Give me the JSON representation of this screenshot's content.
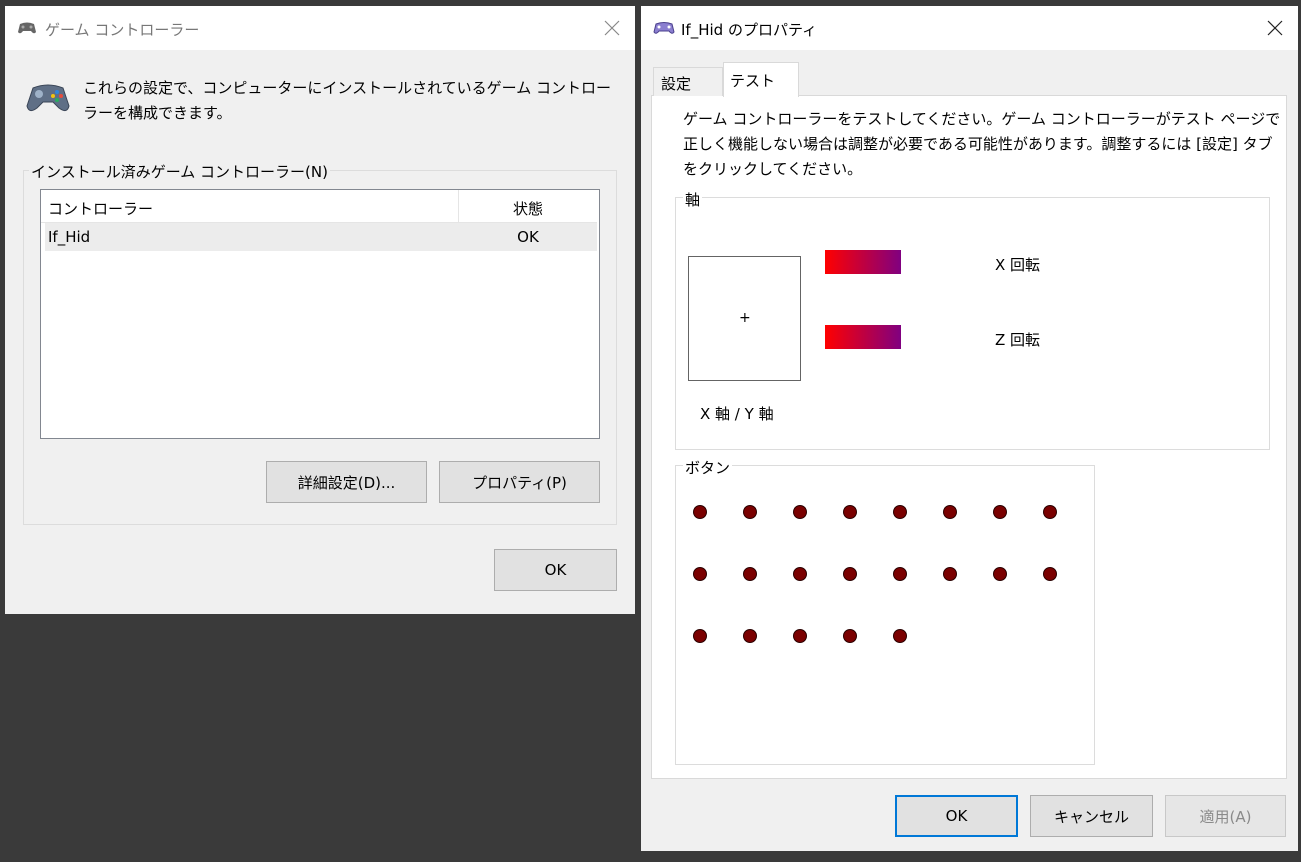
{
  "left_window": {
    "title": "ゲーム コントローラー",
    "description": "これらの設定で、コンピューターにインストールされているゲーム コントローラーを構成できます。",
    "group_label": "インストール済みゲーム コントローラー(N)",
    "columns": [
      "コントローラー",
      "状態"
    ],
    "rows": [
      {
        "name": "If_Hid",
        "status": "OK"
      }
    ],
    "advanced_button": "詳細設定(D)...",
    "properties_button": "プロパティ(P)",
    "ok_button": "OK"
  },
  "right_window": {
    "title": "If_Hid のプロパティ",
    "tabs": [
      "設定",
      "テスト"
    ],
    "active_tab": "テスト",
    "instructions": "ゲーム コントローラーをテストしてください。ゲーム コントローラーがテスト ページで正しく機能しない場合は調整が必要である可能性があります。調整するには [設定] タブをクリックしてください。",
    "axes_label": "軸",
    "xy_axis_label": "X 軸 / Y 軸",
    "crosshair": "+",
    "x_rotation_label": "X 回転",
    "z_rotation_label": "Z 回転",
    "buttons_label": "ボタン",
    "button_count": 21,
    "ok_button": "OK",
    "cancel_button": "キャンセル",
    "apply_button": "適用(A)"
  },
  "colors": {
    "button_indicator": "#7a0000",
    "bar_start": "#ff0000",
    "bar_end": "#800080",
    "default_button_border": "#0078d7"
  }
}
